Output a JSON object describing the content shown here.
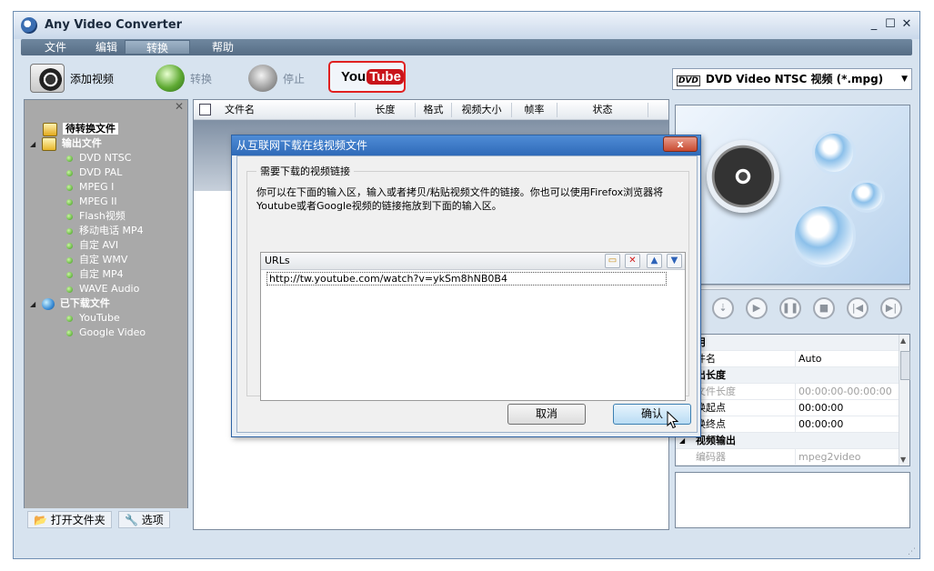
{
  "window": {
    "title": "Any Video Converter",
    "controls": [
      "_",
      "☐",
      "✕"
    ]
  },
  "menu": {
    "items": [
      "文件",
      "编辑",
      "转换",
      "帮助"
    ],
    "active_index": 2
  },
  "toolbar": {
    "add_video": "添加视频",
    "convert": "转换",
    "stop": "停止",
    "youtube_you": "You",
    "youtube_tube": "Tube",
    "profile": "DVD Video NTSC 视频 (*.mpg)",
    "profile_badge": "DVD"
  },
  "tree": {
    "root": "待转换文件",
    "output": "输出文件",
    "output_items": [
      "DVD NTSC",
      "DVD PAL",
      "MPEG I",
      "MPEG II",
      "Flash视频",
      "移动电话 MP4",
      "自定 AVI",
      "自定 WMV",
      "自定 MP4",
      "WAVE Audio"
    ],
    "downloaded": "已下载文件",
    "downloaded_items": [
      "YouTube",
      "Google Video"
    ]
  },
  "left_bottom": {
    "open_folder": "打开文件夹",
    "options": "选项"
  },
  "file_list": {
    "columns": [
      "文件名",
      "长度",
      "格式",
      "视频大小",
      "帧率",
      "状态"
    ]
  },
  "properties": {
    "rows": [
      {
        "key": "用",
        "value": "",
        "group": true
      },
      {
        "key": "件名",
        "value": "Auto",
        "group": false
      },
      {
        "key": "出长度",
        "value": "",
        "group": true
      },
      {
        "key": "文件长度",
        "value": "00:00:00-00:00:00",
        "group": false,
        "disabled": true
      },
      {
        "key": "换起点",
        "value": "00:00:00",
        "group": false
      },
      {
        "key": "换终点",
        "value": "00:00:00",
        "group": false
      },
      {
        "key": "视频输出",
        "value": "",
        "group": true
      },
      {
        "key": "编码器",
        "value": "mpeg2video",
        "group": false,
        "disabled": true
      }
    ]
  },
  "dialog": {
    "title": "从互联网下载在线视频文件",
    "close": "x",
    "group_title": "需要下载的视频链接",
    "description": "你可以在下面的输入区，输入或者拷贝/粘贴视频文件的链接。你也可以使用Firefox浏览器将Youtube或者Google视频的链接拖放到下面的输入区。",
    "urls_label": "URLs",
    "url_value": "http://tw.youtube.com/watch?v=ykSm8hNB0B4",
    "cancel": "取消",
    "ok": "确认"
  },
  "colors": {
    "accent": "#2f6ab8",
    "youtube_red": "#c9141a",
    "highlight_border": "#e02020"
  }
}
